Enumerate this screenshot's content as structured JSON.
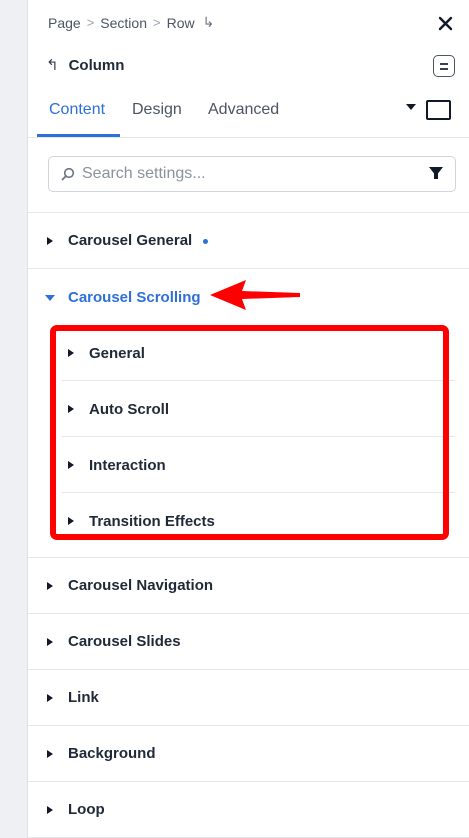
{
  "breadcrumb": {
    "items": [
      "Page",
      "Section",
      "Row"
    ],
    "separator": ">",
    "return_glyph": "↳"
  },
  "header": {
    "undo_glyph": "↰",
    "element_title": "Column"
  },
  "tabs": [
    {
      "label": "Content",
      "active": true
    },
    {
      "label": "Design",
      "active": false
    },
    {
      "label": "Advanced",
      "active": false
    }
  ],
  "search": {
    "placeholder": "Search settings...",
    "value": ""
  },
  "sections": [
    {
      "label": "Carousel General",
      "expanded": false,
      "modified_dot": true
    },
    {
      "label": "Carousel Scrolling",
      "expanded": true,
      "subsections": [
        {
          "label": "General"
        },
        {
          "label": "Auto Scroll"
        },
        {
          "label": "Interaction"
        },
        {
          "label": "Transition Effects"
        }
      ]
    },
    {
      "label": "Carousel Navigation",
      "expanded": false
    },
    {
      "label": "Carousel Slides",
      "expanded": false
    },
    {
      "label": "Link",
      "expanded": false
    },
    {
      "label": "Background",
      "expanded": false
    },
    {
      "label": "Loop",
      "expanded": false
    }
  ],
  "colors": {
    "accent": "#2f6fd8",
    "annotation": "#ff0000",
    "text": "#1f2937"
  },
  "annotation": {
    "arrow_color": "#ff0000",
    "box_color": "#ff0000"
  }
}
